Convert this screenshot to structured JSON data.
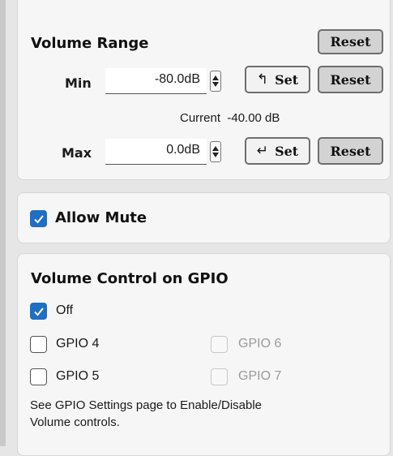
{
  "volume_range": {
    "title": "Volume Range",
    "reset_label": "Reset",
    "min": {
      "label": "Min",
      "value": "-80.0dB",
      "set_label": "Set",
      "reset_label": "Reset"
    },
    "current": "Current  -40.00 dB",
    "max": {
      "label": "Max",
      "value": "0.0dB",
      "set_label": "Set",
      "reset_label": "Reset"
    }
  },
  "mute": {
    "label": "Allow Mute",
    "checked": true
  },
  "gpio": {
    "title": "Volume Control on GPIO",
    "options": [
      {
        "label": "Off",
        "checked": true,
        "enabled": true
      },
      {
        "label": "GPIO 4",
        "checked": false,
        "enabled": true
      },
      {
        "label": "GPIO 6",
        "checked": false,
        "enabled": false
      },
      {
        "label": "GPIO 5",
        "checked": false,
        "enabled": true
      },
      {
        "label": "GPIO 7",
        "checked": false,
        "enabled": false
      }
    ],
    "note_line1": "See GPIO Settings page to Enable/Disable",
    "note_line2": "Volume controls."
  },
  "colors": {
    "accent": "#1f6fc2",
    "panel": "#f6f6f6",
    "background": "#e6e6e6"
  }
}
